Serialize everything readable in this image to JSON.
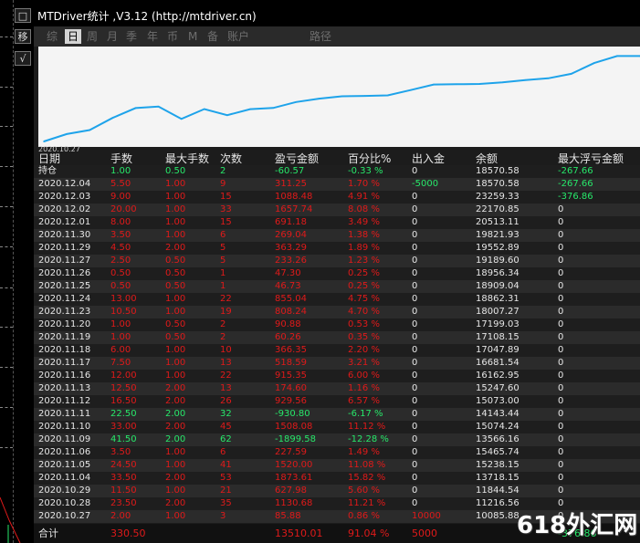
{
  "window": {
    "title": "MTDriver统计 ,V3.12 (http://mtdriver.cn)"
  },
  "left_strip": {
    "btn_top": "□",
    "btn_move": "移",
    "btn_check": "√"
  },
  "tabs": [
    {
      "label": "综",
      "active": false
    },
    {
      "label": "日",
      "active": true
    },
    {
      "label": "周",
      "active": false
    },
    {
      "label": "月",
      "active": false
    },
    {
      "label": "季",
      "active": false
    },
    {
      "label": "年",
      "active": false
    },
    {
      "label": "币",
      "active": false
    },
    {
      "label": "M",
      "active": false
    },
    {
      "label": "备",
      "active": false
    },
    {
      "label": "账户",
      "active": false
    },
    {
      "label": "路径",
      "active": false
    }
  ],
  "chart_data": {
    "type": "line",
    "x_start_label": "2020.10.27",
    "line_color": "#1ea3ea",
    "x": [
      "2020.10.27",
      "2020.10.28",
      "2020.10.29",
      "2020.11.04",
      "2020.11.05",
      "2020.11.06",
      "2020.11.09",
      "2020.11.10",
      "2020.11.11",
      "2020.11.12",
      "2020.11.13",
      "2020.11.16",
      "2020.11.17",
      "2020.11.18",
      "2020.11.19",
      "2020.11.20",
      "2020.11.23",
      "2020.11.24",
      "2020.11.25",
      "2020.11.26",
      "2020.11.27",
      "2020.11.29",
      "2020.11.30",
      "2020.12.01",
      "2020.12.02",
      "2020.12.03",
      "2020.12.04"
    ],
    "values": [
      10085.88,
      11216.56,
      11844.54,
      13718.15,
      15238.15,
      15465.74,
      13566.16,
      15074.24,
      14143.44,
      15073.0,
      15247.6,
      16162.95,
      16681.54,
      17047.89,
      17108.15,
      17199.03,
      18007.27,
      18862.31,
      18909.04,
      18956.34,
      19189.6,
      19552.89,
      19821.93,
      20513.11,
      22170.85,
      23259.33,
      23259.33
    ],
    "ylim": [
      9800,
      23600
    ],
    "grid": false,
    "legend": "none"
  },
  "table": {
    "headers": [
      "日期",
      "手数",
      "最大手数",
      "次数",
      "盈亏金额",
      "百分比%",
      "出入金",
      "余额",
      "最大浮亏金额"
    ],
    "rows": [
      [
        "持仓",
        "1.00",
        "0.50",
        "2",
        "-60.57",
        "-0.33 %",
        "0",
        "18570.58",
        "-267.66"
      ],
      [
        "2020.12.04",
        "5.50",
        "1.00",
        "9",
        "311.25",
        "1.70 %",
        "-5000",
        "18570.58",
        "-267.66"
      ],
      [
        "2020.12.03",
        "9.00",
        "1.00",
        "15",
        "1088.48",
        "4.91 %",
        "0",
        "23259.33",
        "-376.86"
      ],
      [
        "2020.12.02",
        "20.00",
        "1.00",
        "33",
        "1657.74",
        "8.08 %",
        "0",
        "22170.85",
        "0"
      ],
      [
        "2020.12.01",
        "8.00",
        "1.00",
        "15",
        "691.18",
        "3.49 %",
        "0",
        "20513.11",
        "0"
      ],
      [
        "2020.11.30",
        "3.50",
        "1.00",
        "6",
        "269.04",
        "1.38 %",
        "0",
        "19821.93",
        "0"
      ],
      [
        "2020.11.29",
        "4.50",
        "2.00",
        "5",
        "363.29",
        "1.89 %",
        "0",
        "19552.89",
        "0"
      ],
      [
        "2020.11.27",
        "2.50",
        "0.50",
        "5",
        "233.26",
        "1.23 %",
        "0",
        "19189.60",
        "0"
      ],
      [
        "2020.11.26",
        "0.50",
        "0.50",
        "1",
        "47.30",
        "0.25 %",
        "0",
        "18956.34",
        "0"
      ],
      [
        "2020.11.25",
        "0.50",
        "0.50",
        "1",
        "46.73",
        "0.25 %",
        "0",
        "18909.04",
        "0"
      ],
      [
        "2020.11.24",
        "13.00",
        "1.00",
        "22",
        "855.04",
        "4.75 %",
        "0",
        "18862.31",
        "0"
      ],
      [
        "2020.11.23",
        "10.50",
        "1.00",
        "19",
        "808.24",
        "4.70 %",
        "0",
        "18007.27",
        "0"
      ],
      [
        "2020.11.20",
        "1.00",
        "0.50",
        "2",
        "90.88",
        "0.53 %",
        "0",
        "17199.03",
        "0"
      ],
      [
        "2020.11.19",
        "1.00",
        "0.50",
        "2",
        "60.26",
        "0.35 %",
        "0",
        "17108.15",
        "0"
      ],
      [
        "2020.11.18",
        "6.00",
        "1.00",
        "10",
        "366.35",
        "2.20 %",
        "0",
        "17047.89",
        "0"
      ],
      [
        "2020.11.17",
        "7.50",
        "1.00",
        "13",
        "518.59",
        "3.21 %",
        "0",
        "16681.54",
        "0"
      ],
      [
        "2020.11.16",
        "12.00",
        "1.00",
        "22",
        "915.35",
        "6.00 %",
        "0",
        "16162.95",
        "0"
      ],
      [
        "2020.11.13",
        "12.50",
        "2.00",
        "13",
        "174.60",
        "1.16 %",
        "0",
        "15247.60",
        "0"
      ],
      [
        "2020.11.12",
        "16.50",
        "2.00",
        "26",
        "929.56",
        "6.57 %",
        "0",
        "15073.00",
        "0"
      ],
      [
        "2020.11.11",
        "22.50",
        "2.00",
        "32",
        "-930.80",
        "-6.17 %",
        "0",
        "14143.44",
        "0"
      ],
      [
        "2020.11.10",
        "33.00",
        "2.00",
        "45",
        "1508.08",
        "11.12 %",
        "0",
        "15074.24",
        "0"
      ],
      [
        "2020.11.09",
        "41.50",
        "2.00",
        "62",
        "-1899.58",
        "-12.28 %",
        "0",
        "13566.16",
        "0"
      ],
      [
        "2020.11.06",
        "3.50",
        "1.00",
        "6",
        "227.59",
        "1.49 %",
        "0",
        "15465.74",
        "0"
      ],
      [
        "2020.11.05",
        "24.50",
        "1.00",
        "41",
        "1520.00",
        "11.08 %",
        "0",
        "15238.15",
        "0"
      ],
      [
        "2020.11.04",
        "33.50",
        "2.00",
        "53",
        "1873.61",
        "15.82 %",
        "0",
        "13718.15",
        "0"
      ],
      [
        "2020.10.29",
        "11.50",
        "1.00",
        "21",
        "627.98",
        "5.60 %",
        "0",
        "11844.54",
        "0"
      ],
      [
        "2020.10.28",
        "23.50",
        "2.00",
        "35",
        "1130.68",
        "11.21 %",
        "0",
        "11216.56",
        "0"
      ],
      [
        "2020.10.27",
        "2.00",
        "1.00",
        "3",
        "85.88",
        "0.86 %",
        "10000",
        "10085.88",
        "0"
      ]
    ],
    "total": {
      "label": "合计",
      "lots": "330.50",
      "pnl": "13510.01",
      "percent": "91.04 %",
      "flow": "5000",
      "float_partial": "-376.86"
    }
  },
  "colors": {
    "positive": "#e01a1a",
    "negative": "#27e86a",
    "neutral": "#e6e6e6",
    "line": "#1ea3ea",
    "total_text": "#e01a1a"
  },
  "watermark": "618外汇网"
}
